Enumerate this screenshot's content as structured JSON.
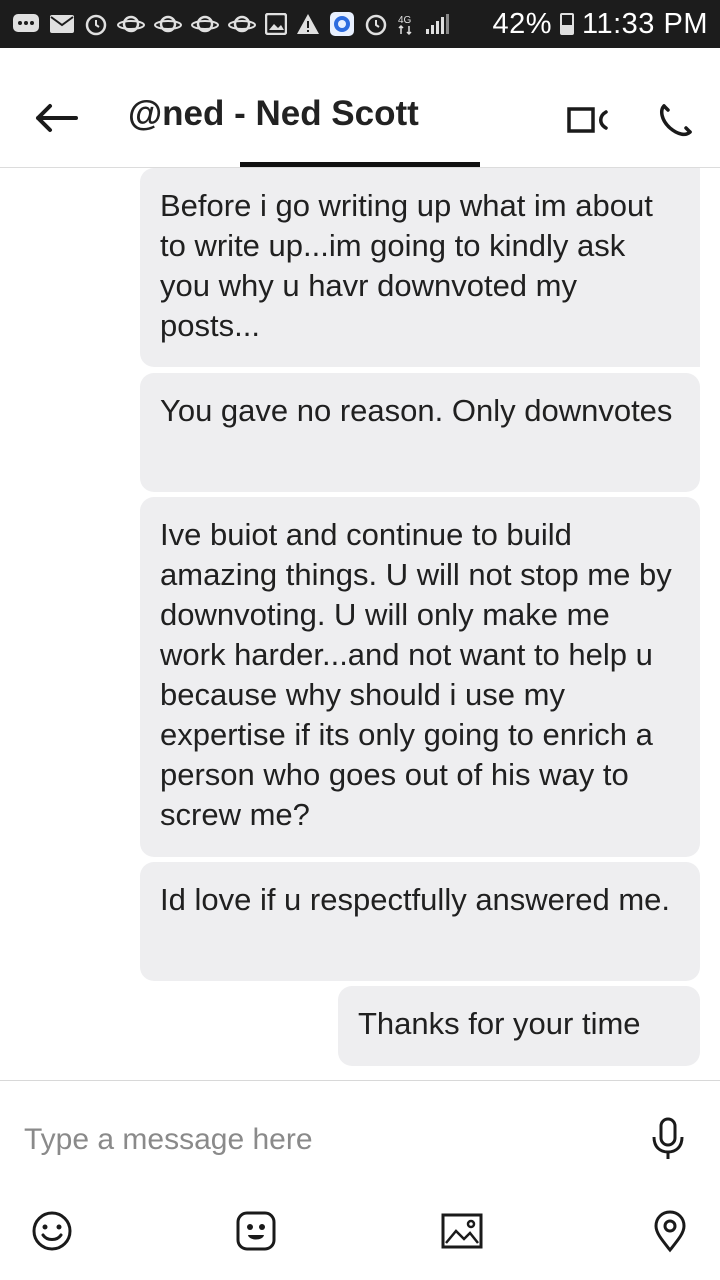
{
  "status_bar": {
    "battery_percent": "42%",
    "time": "11:33 PM",
    "battery_level": 0.42,
    "icons": [
      "messages-icon",
      "mail-icon",
      "alarm-icon",
      "planet-icon",
      "planet-icon",
      "planet-icon",
      "planet-icon",
      "image-icon",
      "warning-icon",
      "browser-icon",
      "alarm-icon",
      "data-icon",
      "signal-icon",
      "battery-icon"
    ]
  },
  "header": {
    "title": "@ned - Ned Scott",
    "back_icon": "arrow-left-icon",
    "video_icon": "video-call-icon",
    "call_icon": "phone-icon"
  },
  "messages": [
    {
      "text": "Before i go writing up what im about to write up...im going to kindly ask you why u havr downvoted my posts...",
      "side": "right"
    },
    {
      "text": "You gave no reason. Only downvotes",
      "side": "right"
    },
    {
      "text": "Ive buiot and continue to build amazing things. U will not stop me by downvoting. U will only make me work harder...and not want to help u because why should i use my expertise if its only going to enrich a person who goes out of his way to screw me?",
      "side": "right"
    },
    {
      "text": "Id love if u respectfully answered me.",
      "side": "right"
    },
    {
      "text": "Thanks for your time",
      "side": "right"
    }
  ],
  "composer": {
    "placeholder": "Type a message here",
    "value": "",
    "mic_icon": "microphone-icon",
    "tools": [
      "emoji-icon",
      "sticker-icon",
      "image-icon",
      "location-pin-icon"
    ]
  },
  "colors": {
    "status_bar_bg": "#1c1c1c",
    "bubble_bg": "#eeeef0",
    "text": "#202020",
    "underline": "#111111"
  }
}
